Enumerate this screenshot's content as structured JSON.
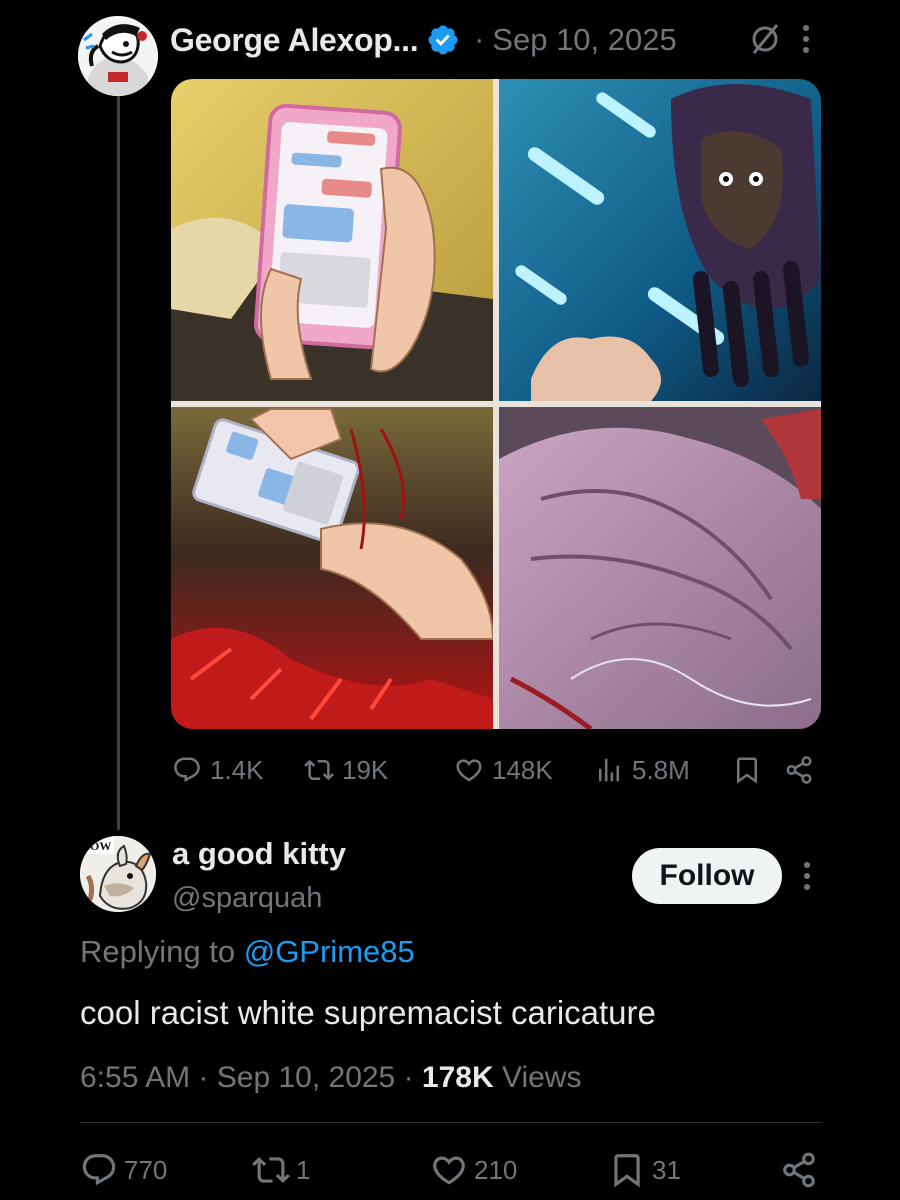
{
  "post": {
    "author_name": "George Alexop...",
    "date": "Sep 10, 2025",
    "stats": {
      "replies": "1.4K",
      "reposts": "19K",
      "likes": "148K",
      "views": "5.8M"
    }
  },
  "reply": {
    "author_name": "a good kitty",
    "handle": "@sparquah",
    "follow_label": "Follow",
    "replying_prefix": "Replying to ",
    "replying_to": "@GPrime85",
    "text": "cool racist white supremacist caricature",
    "time": "6:55 AM",
    "date": "Sep 10, 2025",
    "views_count": "178K",
    "views_label": "Views",
    "avatar_text": "EOW",
    "stats": {
      "replies": "770",
      "reposts": "1",
      "likes": "210",
      "bookmarks": "31"
    }
  },
  "colors": {
    "background": "#000000",
    "text_primary": "#e7e9ea",
    "text_secondary": "#71767b",
    "link": "#1d9bf0",
    "follow_button_bg": "#eff3f4"
  },
  "icons": [
    "verified-badge-icon",
    "mute-icon",
    "more-icon",
    "reply-icon",
    "repost-icon",
    "like-icon",
    "views-icon",
    "bookmark-icon",
    "share-icon"
  ]
}
